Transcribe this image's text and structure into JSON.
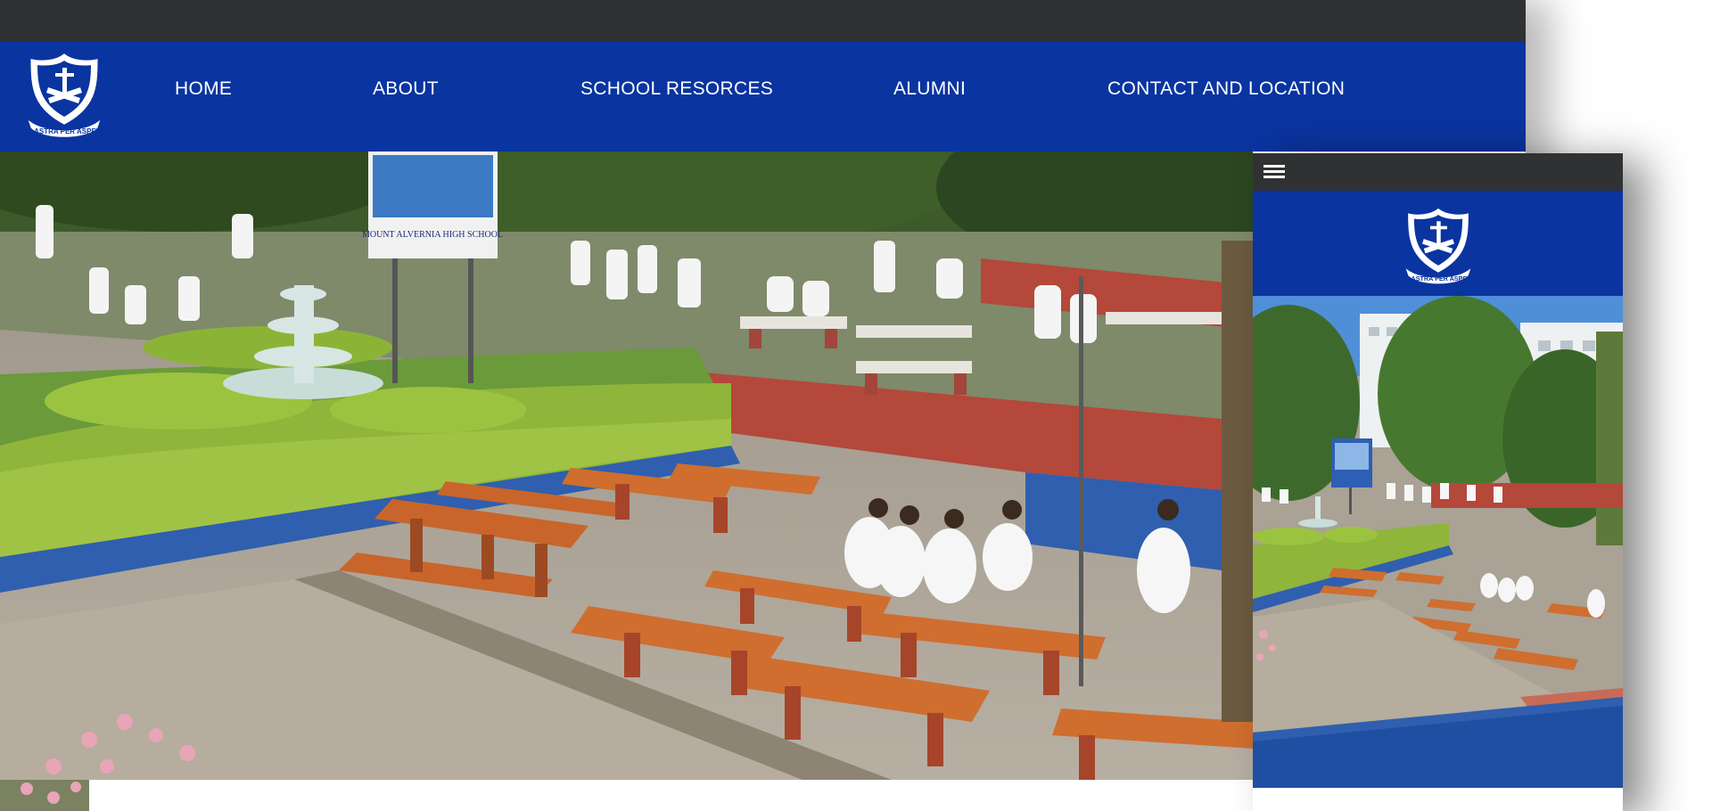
{
  "brand": {
    "logo_icon": "crest-logo-icon",
    "motto": "AD ASTRA PER ASPERA",
    "nav_color": "#0a34a0",
    "topbar_color": "#2f3133"
  },
  "nav": {
    "items": [
      {
        "label": "HOME"
      },
      {
        "label": "ABOUT"
      },
      {
        "label": "SCHOOL RESORCES"
      },
      {
        "label": "ALUMNI"
      },
      {
        "label": "CONTACT AND LOCATION"
      }
    ]
  },
  "hero": {
    "sign_text": "MOUNT ALVERNIA HIGH SCHOOL",
    "image_icon": "school-courtyard-photo"
  },
  "mobile": {
    "menu_icon": "hamburger-menu-icon",
    "hero_image_icon": "school-building-courtyard-photo"
  }
}
